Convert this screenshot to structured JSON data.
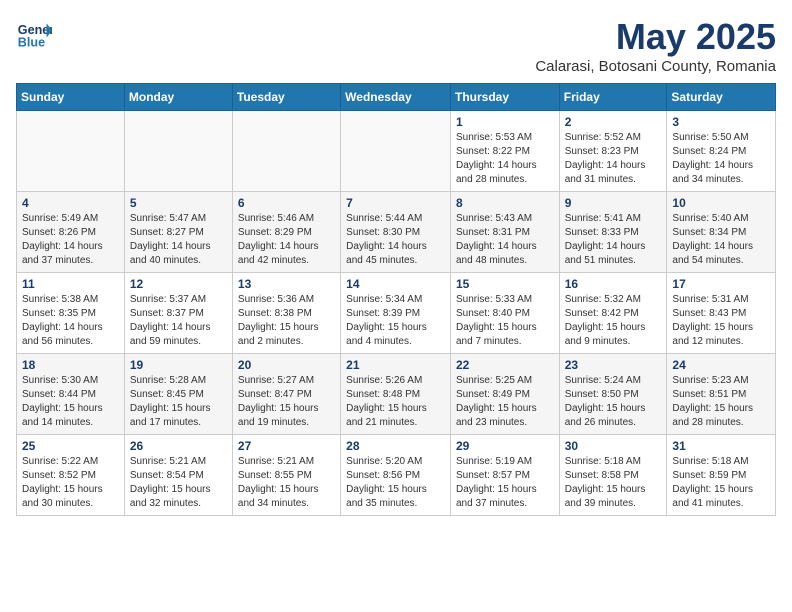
{
  "header": {
    "logo_line1": "General",
    "logo_line2": "Blue",
    "title": "May 2025",
    "subtitle": "Calarasi, Botosani County, Romania"
  },
  "weekdays": [
    "Sunday",
    "Monday",
    "Tuesday",
    "Wednesday",
    "Thursday",
    "Friday",
    "Saturday"
  ],
  "weeks": [
    [
      {
        "day": "",
        "info": ""
      },
      {
        "day": "",
        "info": ""
      },
      {
        "day": "",
        "info": ""
      },
      {
        "day": "",
        "info": ""
      },
      {
        "day": "1",
        "info": "Sunrise: 5:53 AM\nSunset: 8:22 PM\nDaylight: 14 hours\nand 28 minutes."
      },
      {
        "day": "2",
        "info": "Sunrise: 5:52 AM\nSunset: 8:23 PM\nDaylight: 14 hours\nand 31 minutes."
      },
      {
        "day": "3",
        "info": "Sunrise: 5:50 AM\nSunset: 8:24 PM\nDaylight: 14 hours\nand 34 minutes."
      }
    ],
    [
      {
        "day": "4",
        "info": "Sunrise: 5:49 AM\nSunset: 8:26 PM\nDaylight: 14 hours\nand 37 minutes."
      },
      {
        "day": "5",
        "info": "Sunrise: 5:47 AM\nSunset: 8:27 PM\nDaylight: 14 hours\nand 40 minutes."
      },
      {
        "day": "6",
        "info": "Sunrise: 5:46 AM\nSunset: 8:29 PM\nDaylight: 14 hours\nand 42 minutes."
      },
      {
        "day": "7",
        "info": "Sunrise: 5:44 AM\nSunset: 8:30 PM\nDaylight: 14 hours\nand 45 minutes."
      },
      {
        "day": "8",
        "info": "Sunrise: 5:43 AM\nSunset: 8:31 PM\nDaylight: 14 hours\nand 48 minutes."
      },
      {
        "day": "9",
        "info": "Sunrise: 5:41 AM\nSunset: 8:33 PM\nDaylight: 14 hours\nand 51 minutes."
      },
      {
        "day": "10",
        "info": "Sunrise: 5:40 AM\nSunset: 8:34 PM\nDaylight: 14 hours\nand 54 minutes."
      }
    ],
    [
      {
        "day": "11",
        "info": "Sunrise: 5:38 AM\nSunset: 8:35 PM\nDaylight: 14 hours\nand 56 minutes."
      },
      {
        "day": "12",
        "info": "Sunrise: 5:37 AM\nSunset: 8:37 PM\nDaylight: 14 hours\nand 59 minutes."
      },
      {
        "day": "13",
        "info": "Sunrise: 5:36 AM\nSunset: 8:38 PM\nDaylight: 15 hours\nand 2 minutes."
      },
      {
        "day": "14",
        "info": "Sunrise: 5:34 AM\nSunset: 8:39 PM\nDaylight: 15 hours\nand 4 minutes."
      },
      {
        "day": "15",
        "info": "Sunrise: 5:33 AM\nSunset: 8:40 PM\nDaylight: 15 hours\nand 7 minutes."
      },
      {
        "day": "16",
        "info": "Sunrise: 5:32 AM\nSunset: 8:42 PM\nDaylight: 15 hours\nand 9 minutes."
      },
      {
        "day": "17",
        "info": "Sunrise: 5:31 AM\nSunset: 8:43 PM\nDaylight: 15 hours\nand 12 minutes."
      }
    ],
    [
      {
        "day": "18",
        "info": "Sunrise: 5:30 AM\nSunset: 8:44 PM\nDaylight: 15 hours\nand 14 minutes."
      },
      {
        "day": "19",
        "info": "Sunrise: 5:28 AM\nSunset: 8:45 PM\nDaylight: 15 hours\nand 17 minutes."
      },
      {
        "day": "20",
        "info": "Sunrise: 5:27 AM\nSunset: 8:47 PM\nDaylight: 15 hours\nand 19 minutes."
      },
      {
        "day": "21",
        "info": "Sunrise: 5:26 AM\nSunset: 8:48 PM\nDaylight: 15 hours\nand 21 minutes."
      },
      {
        "day": "22",
        "info": "Sunrise: 5:25 AM\nSunset: 8:49 PM\nDaylight: 15 hours\nand 23 minutes."
      },
      {
        "day": "23",
        "info": "Sunrise: 5:24 AM\nSunset: 8:50 PM\nDaylight: 15 hours\nand 26 minutes."
      },
      {
        "day": "24",
        "info": "Sunrise: 5:23 AM\nSunset: 8:51 PM\nDaylight: 15 hours\nand 28 minutes."
      }
    ],
    [
      {
        "day": "25",
        "info": "Sunrise: 5:22 AM\nSunset: 8:52 PM\nDaylight: 15 hours\nand 30 minutes."
      },
      {
        "day": "26",
        "info": "Sunrise: 5:21 AM\nSunset: 8:54 PM\nDaylight: 15 hours\nand 32 minutes."
      },
      {
        "day": "27",
        "info": "Sunrise: 5:21 AM\nSunset: 8:55 PM\nDaylight: 15 hours\nand 34 minutes."
      },
      {
        "day": "28",
        "info": "Sunrise: 5:20 AM\nSunset: 8:56 PM\nDaylight: 15 hours\nand 35 minutes."
      },
      {
        "day": "29",
        "info": "Sunrise: 5:19 AM\nSunset: 8:57 PM\nDaylight: 15 hours\nand 37 minutes."
      },
      {
        "day": "30",
        "info": "Sunrise: 5:18 AM\nSunset: 8:58 PM\nDaylight: 15 hours\nand 39 minutes."
      },
      {
        "day": "31",
        "info": "Sunrise: 5:18 AM\nSunset: 8:59 PM\nDaylight: 15 hours\nand 41 minutes."
      }
    ]
  ]
}
